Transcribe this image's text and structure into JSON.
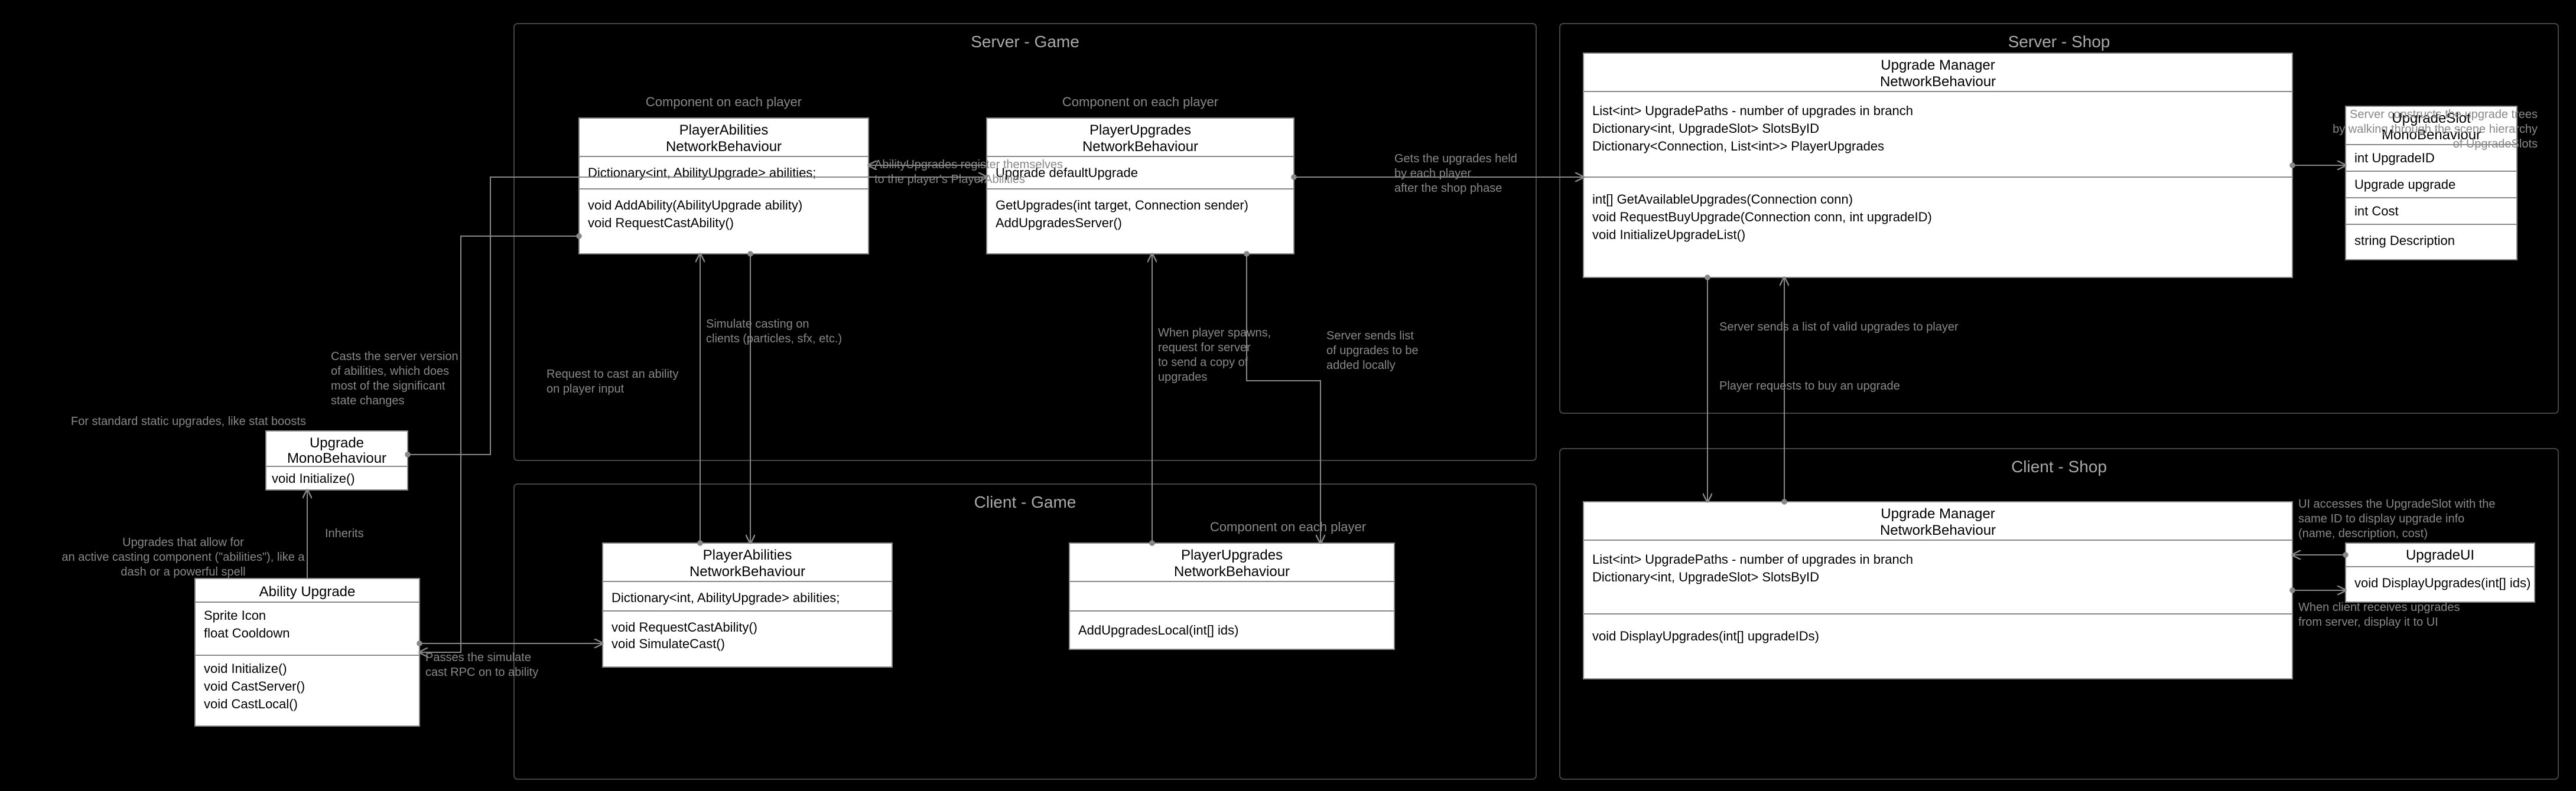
{
  "zones": {
    "server_game": "Server - Game",
    "client_game": "Client - Game",
    "server_shop": "Server - Shop",
    "client_shop": "Client - Shop"
  },
  "sublabels": {
    "component_on_each_player": "Component on each player"
  },
  "upgrade": {
    "title": "Upgrade",
    "sub": "MonoBehaviour",
    "m1": "void Initialize()"
  },
  "ability_upgrade": {
    "title": "Ability Upgrade",
    "f1": "Sprite Icon",
    "f2": "float Cooldown",
    "m1": "void Initialize()",
    "m2": "void CastServer()",
    "m3": "void CastLocal()"
  },
  "server_player_abilities": {
    "title": "PlayerAbilities",
    "sub": "NetworkBehaviour",
    "f1": "Dictionary<int, AbilityUpgrade> abilities;",
    "m1": "void AddAbility(AbilityUpgrade ability)",
    "m2": "void RequestCastAbility()"
  },
  "client_player_abilities": {
    "title": "PlayerAbilities",
    "sub": "NetworkBehaviour",
    "f1": "Dictionary<int, AbilityUpgrade> abilities;",
    "m1": "void RequestCastAbility()",
    "m2": "void SimulateCast()"
  },
  "server_player_upgrades": {
    "title": "PlayerUpgrades",
    "sub": "NetworkBehaviour",
    "f1": "Upgrade defaultUpgrade",
    "m1": "GetUpgrades(int target, Connection sender)",
    "m2": "AddUpgradesServer()"
  },
  "client_player_upgrades": {
    "title": "PlayerUpgrades",
    "sub": "NetworkBehaviour",
    "m1": "AddUpgradesLocal(int[] ids)"
  },
  "server_upgrade_manager": {
    "title": "Upgrade Manager",
    "sub": "NetworkBehaviour",
    "f1": "List<int> UpgradePaths - number of upgrades in branch",
    "f2": "Dictionary<int, UpgradeSlot> SlotsByID",
    "f3": "Dictionary<Connection, List<int>> PlayerUpgrades",
    "m1": "int[] GetAvailableUpgrades(Connection conn)",
    "m2": "void RequestBuyUpgrade(Connection conn, int upgradeID)",
    "m3": "void InitializeUpgradeList()"
  },
  "client_upgrade_manager": {
    "title": "Upgrade Manager",
    "sub": "NetworkBehaviour",
    "f1": "List<int> UpgradePaths - number of upgrades in branch",
    "f2": "Dictionary<int, UpgradeSlot> SlotsByID",
    "m1": "void DisplayUpgrades(int[] upgradeIDs)"
  },
  "upgrade_slot": {
    "title": "UpgradeSlot",
    "sub": "MonoBehaviour",
    "f1": "int UpgradeID",
    "f2": "Upgrade upgrade",
    "f3": "int Cost",
    "f4": "string Description"
  },
  "upgrade_ui": {
    "title": "UpgradeUI",
    "m1": "void DisplayUpgrades(int[] ids)"
  },
  "notes": {
    "static_upgrades": "For standard static upgrades, like stat boosts",
    "active_upgrades_l1": "Upgrades that allow for",
    "active_upgrades_l2": "an active casting component (\"abilities\"), like a",
    "active_upgrades_l3": "dash or a powerful spell",
    "inherits": "Inherits",
    "passes_simulate_l1": "Passes the simulate",
    "passes_simulate_l2": "cast RPC on to ability",
    "casts_server_l1": "Casts the server version",
    "casts_server_l2": "of abilities, which does",
    "casts_server_l3": "most of the significant",
    "casts_server_l4": "state changes",
    "request_cast_l1": "Request to cast an ability",
    "request_cast_l2": "on player input",
    "simulate_casting_l1": "Simulate casting on",
    "simulate_casting_l2": "clients (particles, sfx, etc.)",
    "ability_register_l1": "AbilityUpgrades register themselves",
    "ability_register_l2": "to the player's PlayerAbilities",
    "player_spawn_l1": "When player spawns,",
    "player_spawn_l2": "request for server",
    "player_spawn_l3": "to send a copy of",
    "player_spawn_l4": "upgrades",
    "server_sends_list_l1": "Server sends list",
    "server_sends_list_l2": "of upgrades to be",
    "server_sends_list_l3": "added locally",
    "gets_upgrades_l1": "Gets the upgrades held",
    "gets_upgrades_l2": "by each player",
    "gets_upgrades_l3": "after the shop phase",
    "server_sends_valid": "Server sends a list of valid upgrades to player",
    "player_requests_buy": "Player requests to buy an upgrade",
    "server_constructs_l1": "Server constructs the upgrade trees",
    "server_constructs_l2": "by walking through the scene hierarchy",
    "server_constructs_l3": "of UpgradeSlots",
    "ui_accesses_l1": "UI accesses the UpgradeSlot with the",
    "ui_accesses_l2": "same ID to display upgrade info",
    "ui_accesses_l3": "(name, description, cost)",
    "when_client_l1": "When client receives upgrades",
    "when_client_l2": "from server, display it to  UI"
  }
}
